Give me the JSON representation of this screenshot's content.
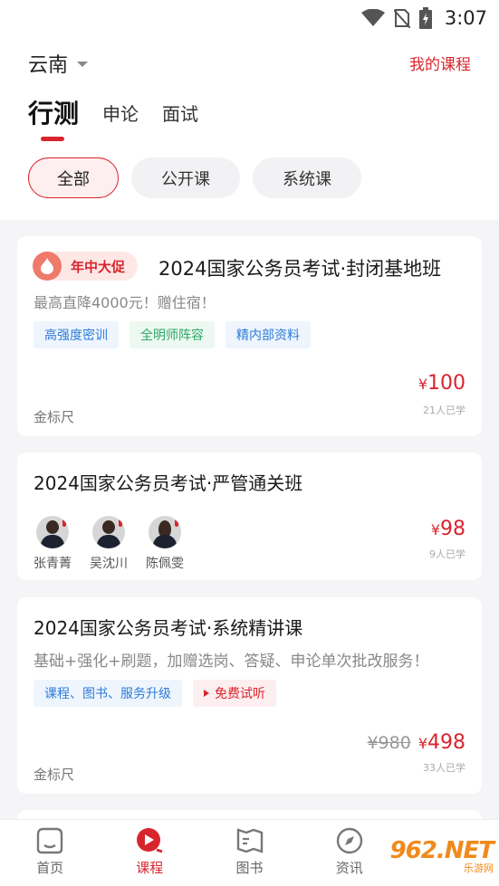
{
  "status": {
    "time": "3:07"
  },
  "header": {
    "region": "云南",
    "my_course": "我的课程"
  },
  "subjects": [
    {
      "label": "行测",
      "active": true
    },
    {
      "label": "申论",
      "active": false
    },
    {
      "label": "面试",
      "active": false
    }
  ],
  "filters": [
    "全部",
    "公开课",
    "系统课"
  ],
  "cards": [
    {
      "promo": "年中大促",
      "title": "2024国家公务员考试·封闭基地班",
      "subtitle": "最高直降4000元！赠住宿！",
      "tags": [
        "高强度密训",
        "全明师阵容",
        "精内部资料"
      ],
      "brand": "金标尺",
      "yen": "¥",
      "price": "100",
      "learners": "21人已学"
    },
    {
      "title": "2024国家公务员考试·严管通关班",
      "teachers": [
        "张青菁",
        "吴沈川",
        "陈佩雯"
      ],
      "yen": "¥",
      "price": "98",
      "learners": "9人已学"
    },
    {
      "title": "2024国家公务员考试·系统精讲课",
      "subtitle": "基础+强化+刷题，加赠选岗、答疑、申论单次批改服务！",
      "tags": [
        "课程、图书、服务升级",
        "免费试听"
      ],
      "brand": "金标尺",
      "old_price": "¥980",
      "yen": "¥",
      "price": "498",
      "learners": "33人已学"
    }
  ],
  "tabbar": [
    {
      "label": "首页",
      "icon": "home-icon"
    },
    {
      "label": "课程",
      "icon": "play-icon",
      "active": true
    },
    {
      "label": "图书",
      "icon": "book-icon"
    },
    {
      "label": "资讯",
      "icon": "compass-icon"
    }
  ],
  "watermark": {
    "big": "962.NET",
    "small": "乐游网"
  },
  "colors": {
    "accent": "#d8252d",
    "bg": "#f5f5f7"
  }
}
